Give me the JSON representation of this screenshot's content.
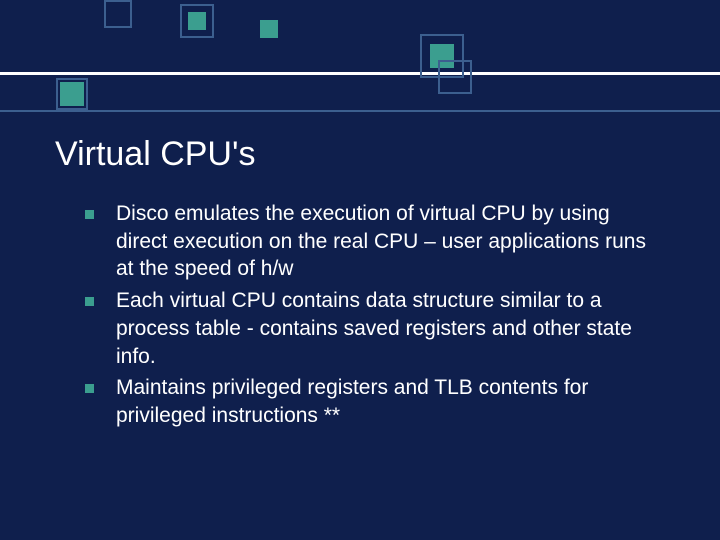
{
  "slide": {
    "title": "Virtual CPU's",
    "bullets": [
      "Disco emulates the execution of virtual CPU by using direct execution on the real CPU – user applications runs at the speed of h/w",
      "Each virtual CPU contains data structure similar to a process table - contains saved registers and other state info.",
      "Maintains privileged registers and TLB contents for privileged instructions **"
    ]
  },
  "theme": {
    "background": "#0f1f4d",
    "accent": "#3b9e8f",
    "line": "#3c5f8f",
    "text": "#ffffff"
  }
}
